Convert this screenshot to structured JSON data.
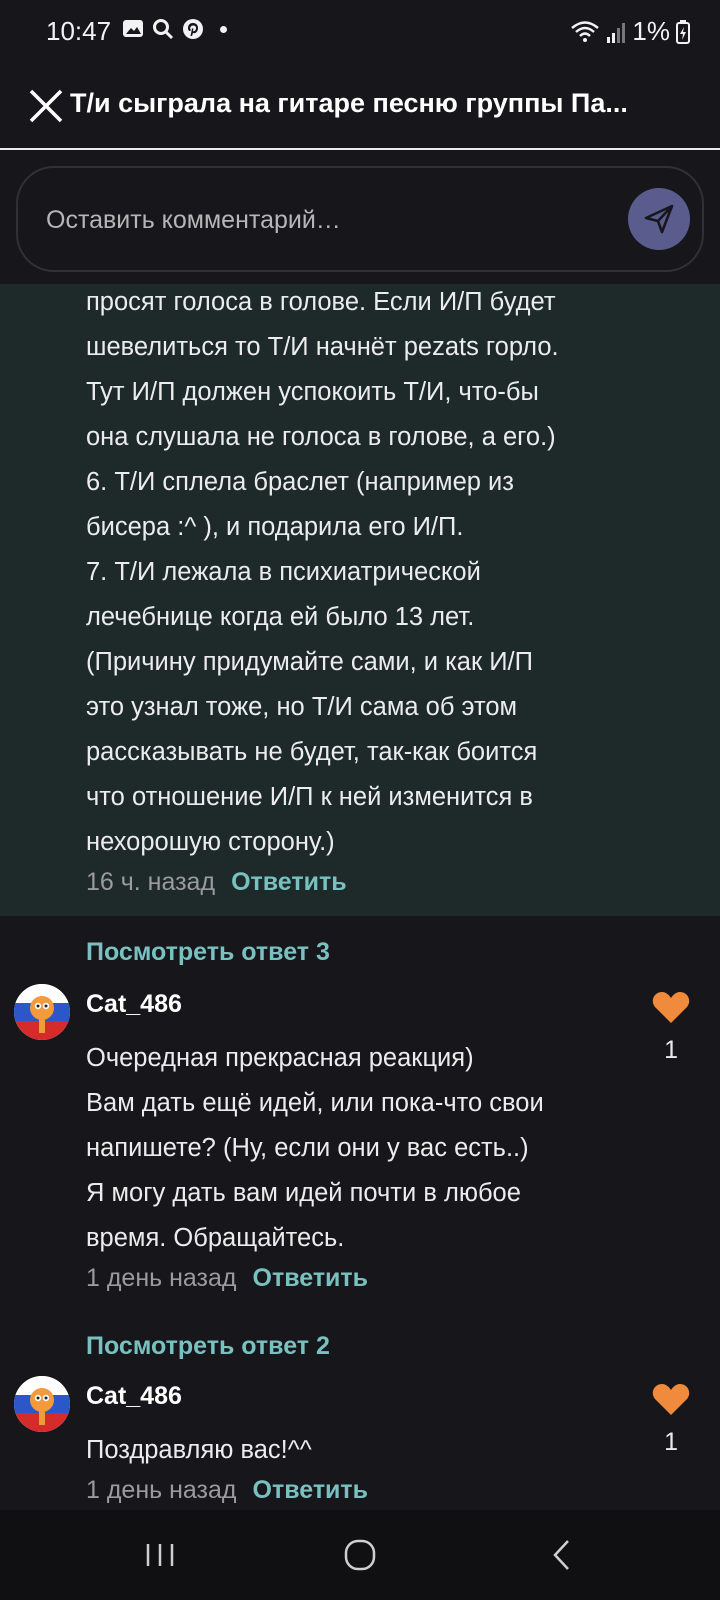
{
  "status_bar": {
    "time": "10:47",
    "battery": "1%",
    "icons": [
      "gallery-icon",
      "search-icon",
      "pinterest-icon",
      "dot-icon",
      "wifi-icon",
      "signal-icon",
      "battery-icon"
    ]
  },
  "header": {
    "title": "Т/и сыграла на гитаре песню группы Па..."
  },
  "comment_input": {
    "placeholder": "Оставить комментарий…"
  },
  "highlighted_comment": {
    "lines": [
      "просят голоса в голове. Если И/П будет",
      "шевелиться то Т/И начнёт pezats горло.",
      "Тут И/П должен успокоить Т/И, что-бы",
      "она слушала не голоса в голове, а его.)",
      "6. Т/И сплела браслет (например из",
      "бисера :^ ), и подарила его И/П.",
      "7. Т/И лежала в психиатрической",
      "лечебнице когда ей было 13 лет.",
      "(Причину придумайте сами, и как И/П",
      "это узнал тоже, но Т/И сама об этом",
      "рассказывать не будет, так-как боится",
      "что отношение И/П к ней изменится в",
      "нехорошую сторону.)"
    ],
    "time": "16 ч. назад",
    "reply_label": "Ответить"
  },
  "comments": [
    {
      "view_replies": "Посмотреть ответ 3",
      "username": "Cat_486",
      "lines": [
        "Очередная прекрасная реакция)",
        "Вам дать ещё идей, или пока-что свои",
        "напишете? (Ну, если они у вас есть..)",
        "Я могу дать вам идей почти в любое",
        "время. Обращайтесь."
      ],
      "likes": "1",
      "time": "1 день назад",
      "reply_label": "Ответить"
    },
    {
      "view_replies": "Посмотреть ответ 2",
      "username": "Cat_486",
      "lines": [
        "Поздравляю вас!^^"
      ],
      "likes": "1",
      "time": "1 день назад",
      "reply_label": "Ответить"
    }
  ],
  "colors": {
    "background": "#17171b",
    "highlight": "#1e292a",
    "accent_teal": "#79c1c1",
    "send_button": "#5a5c8e",
    "heart": "#f08a3c"
  }
}
